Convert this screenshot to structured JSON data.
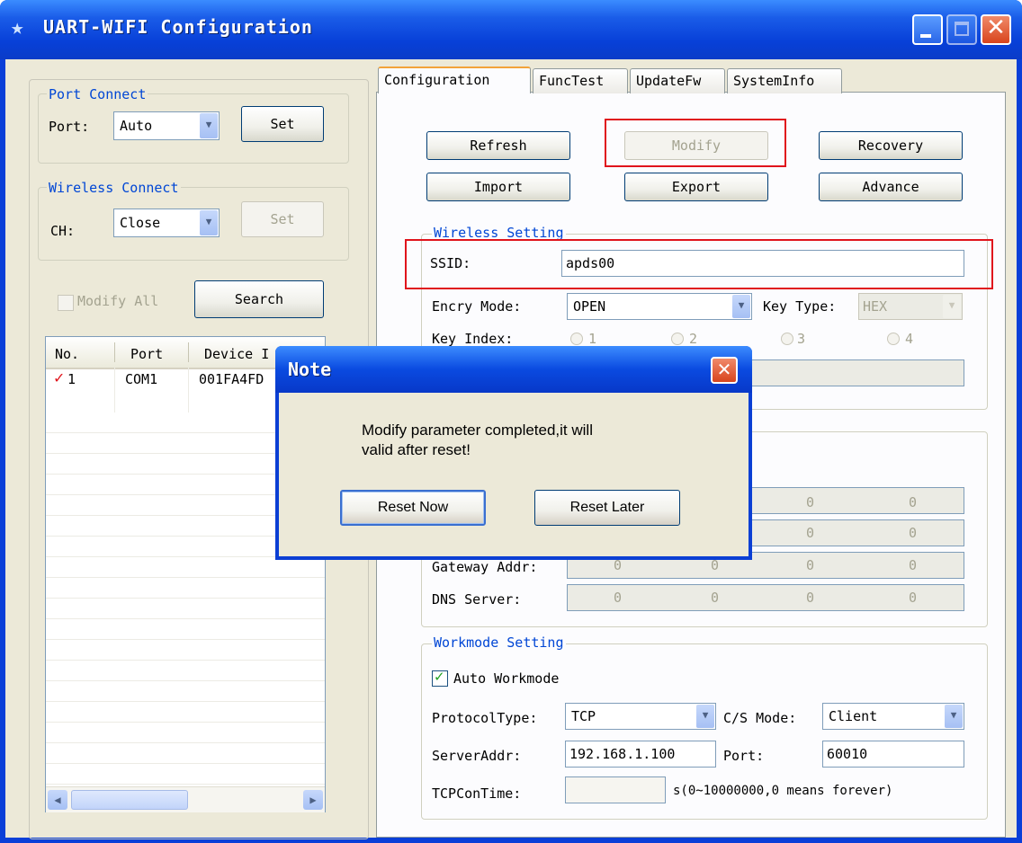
{
  "window": {
    "title": "UART-WIFI Configuration"
  },
  "port_connect": {
    "label": "Port Connect",
    "port_label": "Port:",
    "port_value": "Auto",
    "set_label": "Set"
  },
  "wireless_connect": {
    "label": "Wireless Connect",
    "ch_label": "CH:",
    "ch_value": "Close",
    "set_label": "Set"
  },
  "left_actions": {
    "modify_all_label": "Modify All",
    "search_label": "Search"
  },
  "device_list": {
    "columns": [
      "No.",
      "Port",
      "Device I"
    ],
    "rows": [
      {
        "no": "1",
        "port": "COM1",
        "device": "001FA4FD"
      }
    ]
  },
  "tabs": [
    "Configuration",
    "FuncTest",
    "UpdateFw",
    "SystemInfo"
  ],
  "actions": {
    "refresh": "Refresh",
    "modify": "Modify",
    "recovery": "Recovery",
    "import": "Import",
    "export": "Export",
    "advance": "Advance"
  },
  "wireless_setting": {
    "label": "Wireless Setting",
    "ssid_label": "SSID:",
    "ssid_value": "apds00",
    "encry_label": "Encry Mode:",
    "encry_value": "OPEN",
    "keytype_label": "Key Type:",
    "keytype_value": "HEX",
    "keyindex_label": "Key Index:",
    "key_options": [
      "1",
      "2",
      "3",
      "4"
    ]
  },
  "network": {
    "gateway_label": "Gateway Addr:",
    "dns_label": "DNS Server:",
    "ip_seg": "0",
    "dot": "."
  },
  "workmode": {
    "label": "Workmode Setting",
    "auto_label": "Auto Workmode",
    "protocol_label": "ProtocolType:",
    "protocol_value": "TCP",
    "cs_label": "C/S Mode:",
    "cs_value": "Client",
    "server_label": "ServerAddr:",
    "server_value": "192.168.1.100",
    "port_label": "Port:",
    "port_value": "60010",
    "tcpcon_label": "TCPConTime:",
    "tcpcon_value": "",
    "tcpcon_hint": "s(0~10000000,0 means forever)"
  },
  "dialog": {
    "title": "Note",
    "message_line1": "Modify parameter completed,it will",
    "message_line2": "valid after reset!",
    "reset_now": "Reset Now",
    "reset_later": "Reset Later"
  },
  "colors": {
    "title_blue": "#0a40d8",
    "face": "#ece9d8",
    "group_label": "#0046d5",
    "highlight_red": "#e0141c"
  },
  "icons": [
    "star-icon",
    "minimize-icon",
    "maximize-icon",
    "close-icon",
    "chevron-down-icon",
    "checkmark-icon",
    "scroll-left-icon",
    "scroll-right-icon"
  ]
}
